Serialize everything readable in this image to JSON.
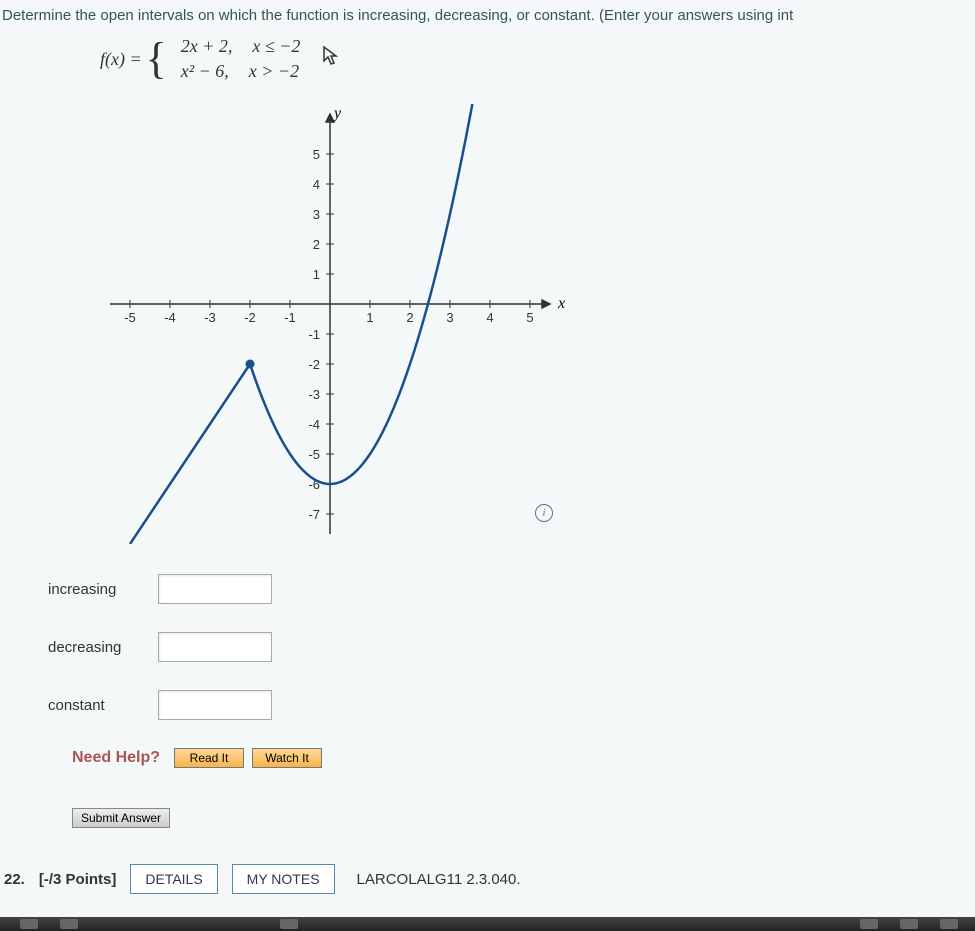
{
  "question": "Determine the open intervals on which the function is increasing, decreasing, or constant. (Enter your answers using int",
  "fn": {
    "lhs": "f(x) =",
    "piece1_expr": "2x + 2,",
    "piece1_cond": "x ≤ −2",
    "piece2_expr": "x² − 6,",
    "piece2_cond": "x > −2"
  },
  "chart_data": {
    "type": "line",
    "title": "",
    "xlabel": "x",
    "ylabel": "y",
    "xlim": [
      -5.5,
      5.5
    ],
    "ylim": [
      -7.5,
      5.5
    ],
    "xticks": [
      -5,
      -4,
      -3,
      -2,
      -1,
      1,
      2,
      3,
      4,
      5
    ],
    "yticks": [
      -7,
      -6,
      -5,
      -4,
      -3,
      -2,
      -1,
      1,
      2,
      3,
      4,
      5
    ],
    "series": [
      {
        "name": "f(x)=2x+2, x≤-2",
        "points": [
          [
            -5,
            -8
          ],
          [
            -4,
            -6
          ],
          [
            -3,
            -4
          ],
          [
            -2,
            -2
          ]
        ],
        "endpoint_closed": [
          -2,
          -2
        ]
      },
      {
        "name": "f(x)=x^2-6, x>-2",
        "points": [
          [
            -2,
            -2
          ],
          [
            -1,
            -5
          ],
          [
            0,
            -6
          ],
          [
            1,
            -5
          ],
          [
            2,
            -2
          ],
          [
            3,
            3
          ],
          [
            3.5,
            6.25
          ]
        ],
        "endpoint_open": [
          -2,
          -2
        ]
      }
    ]
  },
  "answers": {
    "increasing": {
      "label": "increasing",
      "value": ""
    },
    "decreasing": {
      "label": "decreasing",
      "value": ""
    },
    "constant": {
      "label": "constant",
      "value": ""
    }
  },
  "help": {
    "label": "Need Help?",
    "read": "Read It",
    "watch": "Watch It"
  },
  "submit": "Submit Answer",
  "footer": {
    "number": "22.",
    "points": "[-/3 Points]",
    "details": "DETAILS",
    "mynotes": "MY NOTES",
    "ref": "LARCOLALG11 2.3.040."
  },
  "info_icon": "i"
}
